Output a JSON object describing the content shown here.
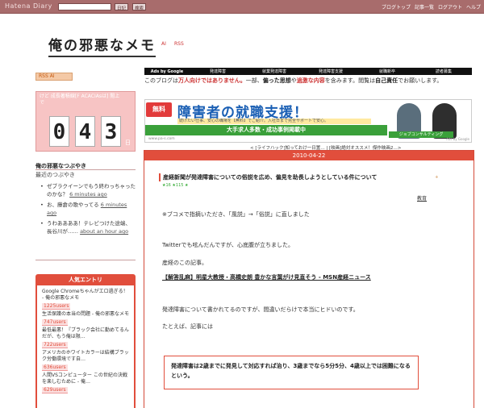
{
  "topbar": {
    "logo": "Hatena Diary",
    "search_placeholder": "",
    "btn_diary": "日記",
    "btn_search": "検索",
    "links": [
      "ブログトップ",
      "記事一覧",
      "ログアウト",
      "ヘルプ"
    ],
    "bg_color": "#a86c6c"
  },
  "site": {
    "title": "俺の邪悪なメモ",
    "tags": [
      "AI",
      "RSS"
    ]
  },
  "sidebar": {
    "rss_label": "RSS AI",
    "counter": {
      "title": "けど 成長著積線[F ACACIAsは] 閲上で",
      "digits": [
        "0",
        "4",
        "3"
      ],
      "unit": "日"
    },
    "bubble": {
      "title": "俺の邪悪なつぶやき",
      "subtitle": "最近のつぶやき",
      "items": [
        {
          "text": "ゼブラクイーンでもう終わっちゃったのかな？",
          "ago": "6 minutes ago"
        },
        {
          "text": "お、藤倉の歌やってる",
          "ago": "6 minutes ago"
        },
        {
          "text": "うわああああ！テレビつけた途端、長谷川が……",
          "ago": "about an hour ago"
        }
      ]
    },
    "popular": {
      "title": "人気エントリ",
      "items": [
        {
          "text": "Google Chromeちゃんがエロ過ぎる！ - 俺の邪悪なメモ",
          "count": "1225users"
        },
        {
          "text": "生活保護の本当の問題 - 俺の邪悪なメモ",
          "count": "747users"
        },
        {
          "text": "最低最悪！『ブラック会社に勤めてるんだが、もう俺は限…",
          "count": "722users"
        },
        {
          "text": "アメリカのホワイトカラーは結構ブラック労働環境です自…",
          "count": "636users"
        },
        {
          "text": "人間VSコンピューター この世紀の決戦を楽しむために - 俺…",
          "count": "629users"
        }
      ]
    }
  },
  "ads": {
    "label": "Ads by Google",
    "links": [
      "発達障害",
      "就業発達障害",
      "発達障害支援",
      "就職新卒",
      "読者募集"
    ]
  },
  "blog_description": {
    "part1": "このブログは",
    "red1": "万人向けではありません。",
    "part2": "一部、",
    "bold1": "偏った思想",
    "part3": "や",
    "red2": "過激な内容",
    "part4": "を含みます。閲覧は",
    "bold2": "自己責任",
    "part5": "でお願いします。"
  },
  "banner": {
    "free": "無料",
    "headline": "障害者の就職支援！",
    "sub": "続けたい仕事、安心の職場を【無料】でご紹介。入社日まで完全サポートで安心。",
    "stripe": "大手求人多数・成功事例掲載中",
    "url": "www.pa-s.com",
    "logo": "ジョブコンサルティング",
    "adby": "Ads by Google"
  },
  "nav": {
    "text": "< [ライフハック]知っておけ一日置… | [映画]絶対オススメ！傑作映画2…>"
  },
  "article": {
    "date": "2010-04-22",
    "title": "産経新聞が発達障害についての俗説を広め、偏見を助長しようとしている件について",
    "plus": "+",
    "stars": "★16 ★115 ★",
    "category": "教育",
    "note": "※ブコメで指摘いただき、「風説」→「俗説」に直しました",
    "para1": "Twitterでも呟んだんですが、心底腹が立ちました。",
    "para2": "産経のこの記事。",
    "link": "【解答乱麻】明星大教授・高橋史朗 豊かな言葉がけ見直そう - MSN産経ニュース",
    "para3": "発達障害について書かれてるのですが、間違いだらけで本当にヒドいのです。",
    "para4": "たとえば、記事には",
    "quote": "発達障害は2歳までに発見して対応すれば治り、3歳までなら5分5分、4歳以上では困難になるという。"
  }
}
